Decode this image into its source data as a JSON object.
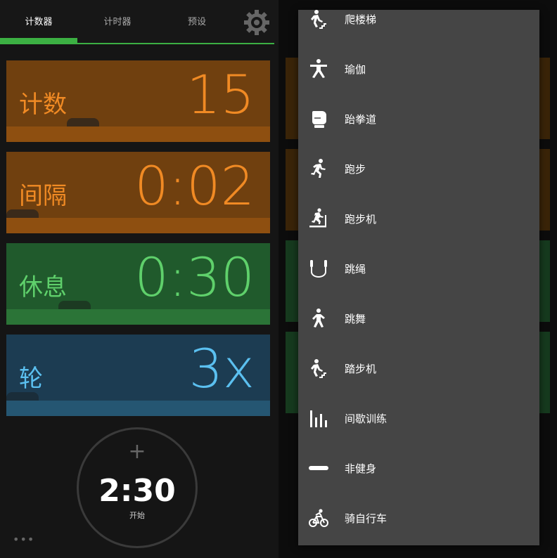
{
  "tabs": {
    "counter": "计数器",
    "timer": "计时器",
    "presets": "预设"
  },
  "cards": {
    "count": {
      "label": "计数",
      "value": "15"
    },
    "interval": {
      "label": "间隔",
      "value": "0:02"
    },
    "rest": {
      "label": "休息",
      "value": "0:30"
    },
    "rounds": {
      "label": "轮",
      "value": "3x"
    }
  },
  "start_button": {
    "plus": "+",
    "time": "2:30",
    "label": "开始"
  },
  "more": "•••",
  "menu": {
    "items": [
      {
        "label": "爬楼梯",
        "icon": "stairs-climb-icon"
      },
      {
        "label": "瑜伽",
        "icon": "yoga-icon"
      },
      {
        "label": "跆拳道",
        "icon": "boxing-glove-icon"
      },
      {
        "label": "跑步",
        "icon": "running-icon"
      },
      {
        "label": "跑步机",
        "icon": "treadmill-icon"
      },
      {
        "label": "跳绳",
        "icon": "jump-rope-icon"
      },
      {
        "label": "跳舞",
        "icon": "dance-icon"
      },
      {
        "label": "踏步机",
        "icon": "stepper-icon"
      },
      {
        "label": "间歇训练",
        "icon": "interval-bars-icon"
      },
      {
        "label": "非健身",
        "icon": "minus-icon"
      },
      {
        "label": "骑自行车",
        "icon": "cycling-icon"
      }
    ]
  },
  "colors": {
    "orange": "#f08a24",
    "green": "#5fd06b",
    "blue": "#5bc0f0",
    "accent": "#3cb043"
  }
}
